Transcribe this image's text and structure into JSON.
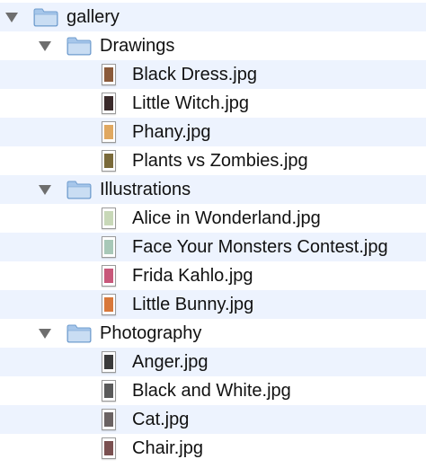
{
  "tree": {
    "root": {
      "label": "gallery",
      "icon": "folder-icon",
      "expanded": true,
      "folders": [
        {
          "label": "Drawings",
          "icon": "folder-icon",
          "expanded": true,
          "files": [
            {
              "label": "Black Dress.jpg",
              "icon": "image-file-icon",
              "thumb": "#8a5a3a"
            },
            {
              "label": "Little Witch.jpg",
              "icon": "image-file-icon",
              "thumb": "#3a2a2a"
            },
            {
              "label": "Phany.jpg",
              "icon": "image-file-icon",
              "thumb": "#e0a860"
            },
            {
              "label": "Plants vs Zombies.jpg",
              "icon": "image-file-icon",
              "thumb": "#7a6a3a"
            }
          ]
        },
        {
          "label": "Illustrations",
          "icon": "folder-icon",
          "expanded": true,
          "files": [
            {
              "label": "Alice in Wonderland.jpg",
              "icon": "image-file-icon",
              "thumb": "#c8d8b8"
            },
            {
              "label": "Face Your Monsters Contest.jpg",
              "icon": "image-file-icon",
              "thumb": "#a8c8b8"
            },
            {
              "label": "Frida Kahlo.jpg",
              "icon": "image-file-icon",
              "thumb": "#c8587a"
            },
            {
              "label": "Little Bunny.jpg",
              "icon": "image-file-icon",
              "thumb": "#d8783a"
            }
          ]
        },
        {
          "label": "Photography",
          "icon": "folder-icon",
          "expanded": true,
          "files": [
            {
              "label": "Anger.jpg",
              "icon": "image-file-icon",
              "thumb": "#3a3a3a"
            },
            {
              "label": "Black and White.jpg",
              "icon": "image-file-icon",
              "thumb": "#5a5a5a"
            },
            {
              "label": "Cat.jpg",
              "icon": "image-file-icon",
              "thumb": "#6a6262"
            },
            {
              "label": "Chair.jpg",
              "icon": "image-file-icon",
              "thumb": "#7a5050"
            }
          ]
        }
      ]
    }
  },
  "colors": {
    "stripe": "#edf3fe",
    "folder_fill": "#a6c6ea",
    "folder_top": "#c9ddf3",
    "folder_stroke": "#6f9cce",
    "disclosure": "#6e6e6e"
  }
}
